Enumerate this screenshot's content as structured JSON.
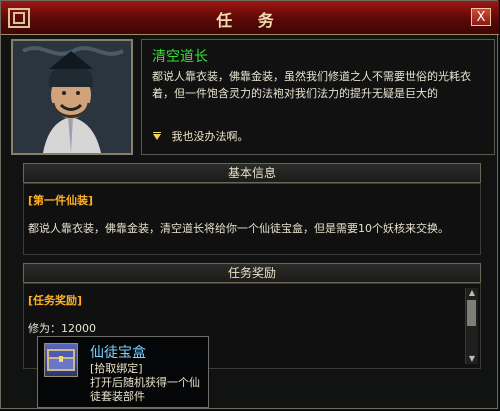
{
  "window": {
    "title": "任  务",
    "close": "X"
  },
  "npc": {
    "name": "清空道长",
    "text": "都说人靠衣装，佛靠金装，虽然我们修道之人不需要世俗的光耗衣着，但一件饱含灵力的法袍对我们法力的提升无疑是巨大的",
    "option": "我也没办法啊。"
  },
  "basic_info": {
    "header": "基本信息",
    "section_title": "[第一件仙装]",
    "description": "都说人靠衣装，佛靠金装，清空道长将给你一个仙徒宝盒，但是需要10个妖核来交换。"
  },
  "reward": {
    "header": "任务奖励",
    "section_title": "[任务奖励]",
    "xiuwei_label": "修为：12000"
  },
  "tooltip": {
    "item_name": "仙徒宝盒",
    "bind": "[拾取绑定]",
    "desc": "打开后随机获得一个仙徒套装部件"
  },
  "colors": {
    "accent_red": "#8a0f0c",
    "npc_green": "#33e133",
    "section_orange": "#ffb020",
    "item_blue": "#78d0ff"
  },
  "icons": [
    "window-corner-icon",
    "close-icon",
    "option-arrow-icon",
    "treasure-box-icon",
    "scroll-up-icon",
    "scroll-down-icon"
  ]
}
